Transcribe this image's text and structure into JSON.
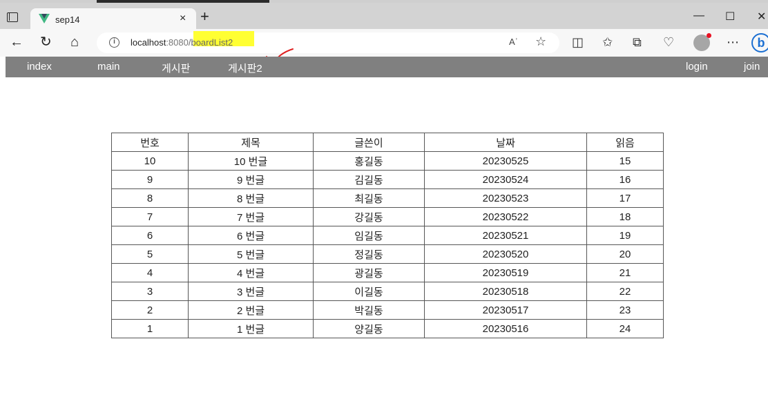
{
  "browser": {
    "tab_title": "sep14",
    "new_tab_label": "+",
    "tab_close_label": "×",
    "window_controls": {
      "minimize": "—",
      "maximize": "☐",
      "close": "✕"
    },
    "url": {
      "host": "localhost",
      "port": ":8080",
      "path": "/boardList2"
    },
    "read_aloud_label": "Aʾ"
  },
  "nav": {
    "left": [
      "index",
      "main",
      "게시판",
      "게시판2"
    ],
    "right": [
      "login",
      "join"
    ]
  },
  "board": {
    "headers": [
      "번호",
      "제목",
      "글쓴이",
      "날짜",
      "읽음"
    ],
    "rows": [
      [
        "10",
        "10 번글",
        "홍길동",
        "20230525",
        "15"
      ],
      [
        "9",
        "9 번글",
        "김길동",
        "20230524",
        "16"
      ],
      [
        "8",
        "8 번글",
        "최길동",
        "20230523",
        "17"
      ],
      [
        "7",
        "7 번글",
        "강길동",
        "20230522",
        "18"
      ],
      [
        "6",
        "6 번글",
        "임길동",
        "20230521",
        "19"
      ],
      [
        "5",
        "5 번글",
        "정길동",
        "20230520",
        "20"
      ],
      [
        "4",
        "4 번글",
        "광길동",
        "20230519",
        "21"
      ],
      [
        "3",
        "3 번글",
        "이길동",
        "20230518",
        "22"
      ],
      [
        "2",
        "2 번글",
        "박길동",
        "20230517",
        "23"
      ],
      [
        "1",
        "1 번글",
        "양길동",
        "20230516",
        "24"
      ]
    ]
  },
  "colors": {
    "nav_bg": "#808080",
    "url_highlight": "#ffff33",
    "annotation": "#e02020",
    "vue_green": "#41b883"
  }
}
